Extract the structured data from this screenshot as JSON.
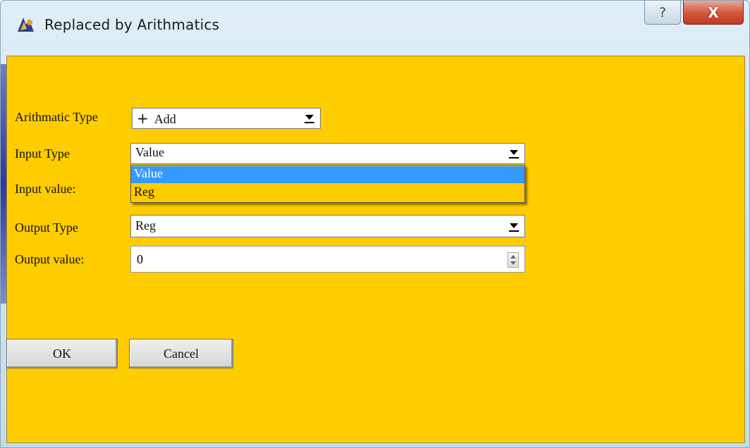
{
  "window": {
    "title": "Replaced by Arithmatics",
    "help_label": "?",
    "close_label": "X",
    "accent_color": "#ffcc00"
  },
  "form": {
    "arithmetic_type": {
      "label": "Arithmatic Type",
      "value": "Add",
      "icon": "plus-icon",
      "icon_glyph": "+"
    },
    "input_type": {
      "label": "Input Type",
      "value": "Value",
      "options": [
        "Value",
        "Reg"
      ],
      "selected_option": "Value"
    },
    "input_value": {
      "label": "Input value:"
    },
    "output_type": {
      "label": "Output Type",
      "value": "Reg"
    },
    "output_value": {
      "label": "Output value:",
      "value": "0"
    }
  },
  "buttons": {
    "ok": "OK",
    "cancel": "Cancel"
  }
}
